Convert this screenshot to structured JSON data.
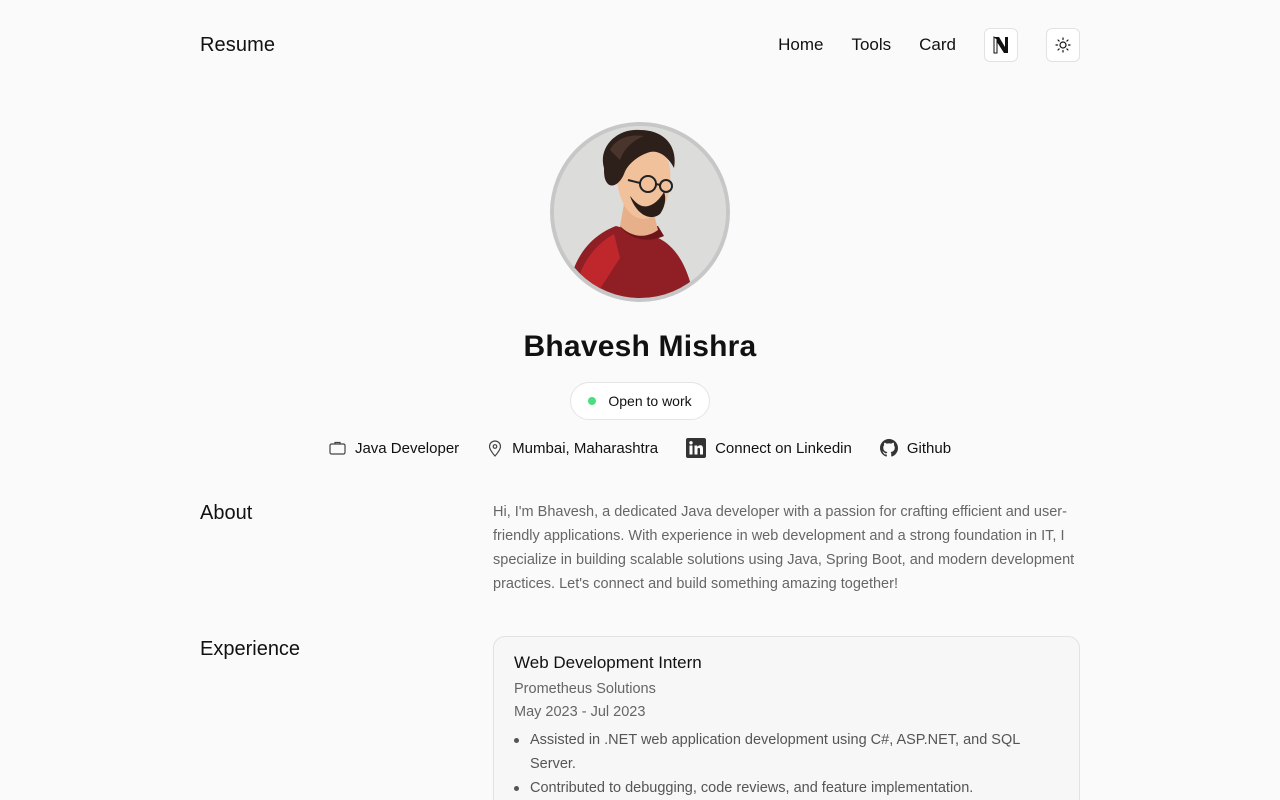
{
  "header": {
    "brand": "Resume",
    "nav": [
      "Home",
      "Tools",
      "Card"
    ],
    "notion_icon": "notion-logo-icon",
    "theme_icon": "sun-icon"
  },
  "profile": {
    "name": "Bhavesh Mishra",
    "status": "Open to work",
    "status_color": "#4ade80",
    "role": "Java Developer",
    "location": "Mumbai, Maharashtra",
    "linkedin": "Connect on Linkedin",
    "github": "Github"
  },
  "about": {
    "title": "About",
    "text": "Hi, I'm Bhavesh, a dedicated Java developer with a passion for crafting efficient and user-friendly applications. With experience in web development and a strong foundation in IT, I specialize in building scalable solutions using Java, Spring Boot, and modern development practices. Let's connect and build something amazing together!"
  },
  "experience": {
    "title": "Experience",
    "items": [
      {
        "role": "Web Development Intern",
        "company": "Prometheus Solutions",
        "dates": "May 2023 - Jul 2023",
        "bullets": [
          "Assisted in .NET web application development using C#, ASP.NET, and SQL Server.",
          "Contributed to debugging, code reviews, and feature implementation."
        ]
      }
    ]
  }
}
